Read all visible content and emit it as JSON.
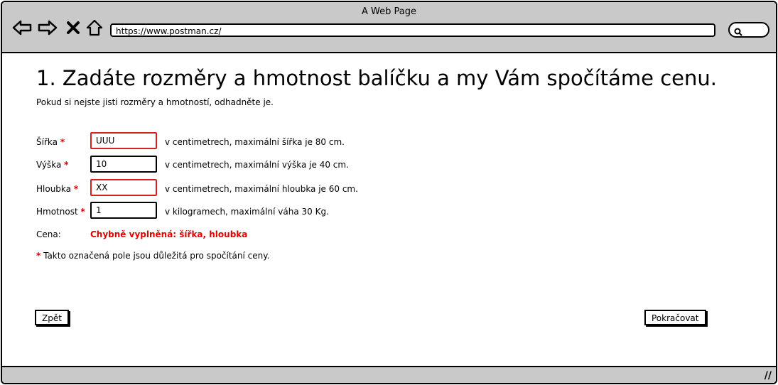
{
  "window": {
    "title": "A Web Page"
  },
  "browser": {
    "url": "https://www.postman.cz/",
    "icons": [
      "back-icon",
      "forward-icon",
      "close-icon",
      "home-icon",
      "search-icon"
    ]
  },
  "page": {
    "heading": "1. Zadáte rozměry a hmotnost balíčku a my Vám spočítáme cenu.",
    "subtitle": "Pokud si nejste jisti rozměry a hmotností, odhadněte je.",
    "fields": [
      {
        "label": "Šířka",
        "value": "UUU",
        "hint": "v centimetrech, maximální šířka je 80 cm."
      },
      {
        "label": "Výška",
        "value": "10",
        "hint": "v centimetrech, maximální výška je 40 cm."
      },
      {
        "label": "Hloubka",
        "value": "XX",
        "hint": "v centimetrech, maximální hloubka je 60 cm."
      },
      {
        "label": "Hmotnost",
        "value": "1",
        "hint": "v kilogramech, maximální váha 30 Kg."
      }
    ],
    "required_mark": "*",
    "price_label": "Cena:",
    "price_error": "Chybně vyplněná: šířka, hloubka",
    "note": "Takto označená pole jsou důležitá pro spočítání ceny.",
    "back_button": "Zpět",
    "continue_button": "Pokračovat"
  },
  "colors": {
    "error": "#e00000",
    "chrome": "#c9c9c9"
  }
}
